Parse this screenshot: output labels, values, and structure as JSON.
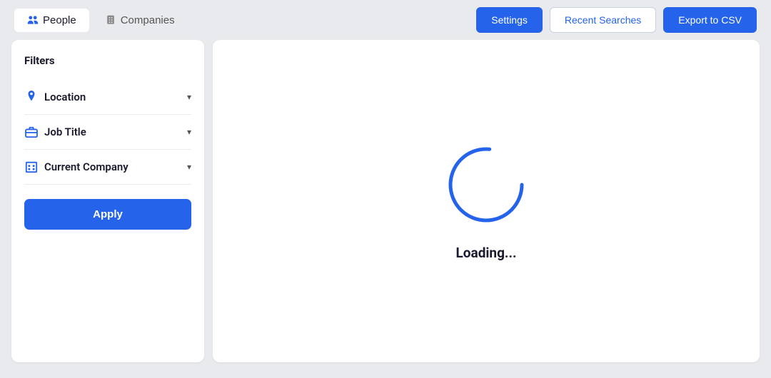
{
  "tabs": {
    "people": {
      "label": "People",
      "active": true
    },
    "companies": {
      "label": "Companies",
      "active": false
    }
  },
  "topActions": {
    "settings": "Settings",
    "recentSearches": "Recent Searches",
    "exportCSV": "Export to CSV"
  },
  "sidebar": {
    "filtersTitle": "Filters",
    "filters": [
      {
        "id": "location",
        "label": "Location",
        "icon": "pin"
      },
      {
        "id": "job-title",
        "label": "Job Title",
        "icon": "briefcase"
      },
      {
        "id": "current-company",
        "label": "Current Company",
        "icon": "building"
      }
    ],
    "applyLabel": "Apply"
  },
  "content": {
    "loadingText": "Loading..."
  }
}
